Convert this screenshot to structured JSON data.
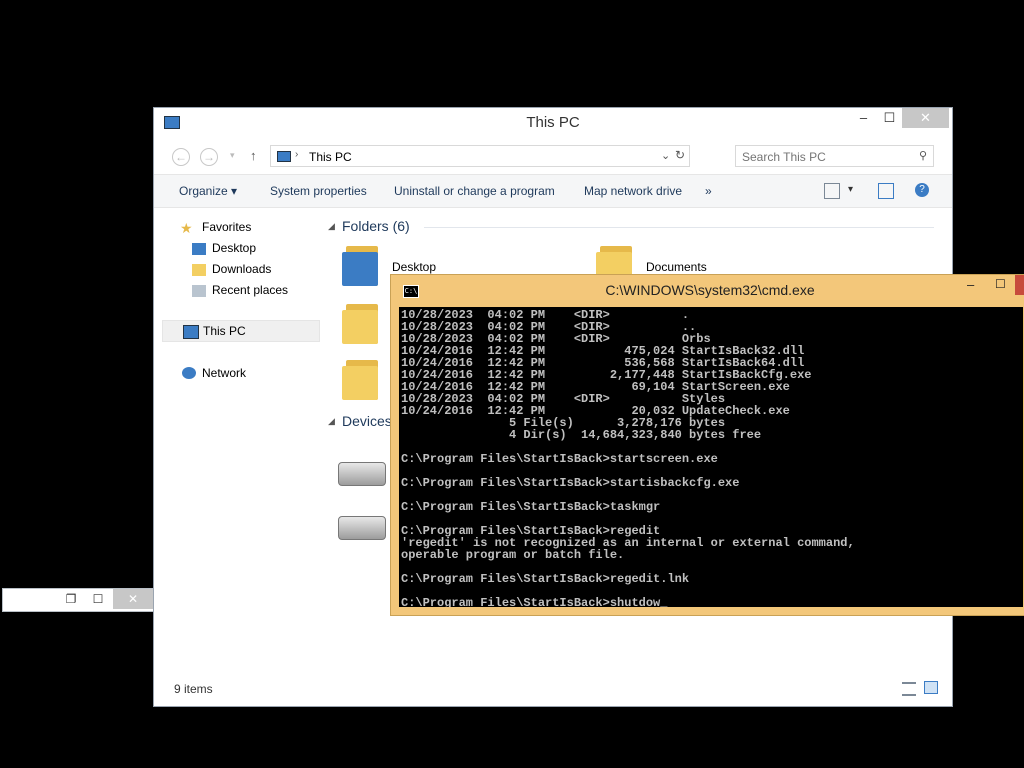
{
  "explorer": {
    "title": "This PC",
    "address": "This PC",
    "search_placeholder": "Search This PC",
    "toolbar": {
      "organize": "Organize",
      "system_properties": "System properties",
      "uninstall": "Uninstall or change a program",
      "map_drive": "Map network drive",
      "more": "»"
    },
    "nav": {
      "favorites": "Favorites",
      "desktop": "Desktop",
      "downloads": "Downloads",
      "recent": "Recent places",
      "this_pc": "This PC",
      "network": "Network"
    },
    "content": {
      "folders_header": "Folders (6)",
      "devices_header": "Devices",
      "desktop_label": "Desktop",
      "documents_label": "Documents"
    },
    "status": "9 items"
  },
  "cmd": {
    "title": "C:\\WINDOWS\\system32\\cmd.exe",
    "lines": [
      "10/28/2023  04:02 PM    <DIR>          .",
      "10/28/2023  04:02 PM    <DIR>          ..",
      "10/28/2023  04:02 PM    <DIR>          Orbs",
      "10/24/2016  12:42 PM           475,024 StartIsBack32.dll",
      "10/24/2016  12:42 PM           536,568 StartIsBack64.dll",
      "10/24/2016  12:42 PM         2,177,448 StartIsBackCfg.exe",
      "10/24/2016  12:42 PM            69,104 StartScreen.exe",
      "10/28/2023  04:02 PM    <DIR>          Styles",
      "10/24/2016  12:42 PM            20,032 UpdateCheck.exe",
      "               5 File(s)      3,278,176 bytes",
      "               4 Dir(s)  14,684,323,840 bytes free",
      "",
      "C:\\Program Files\\StartIsBack>startscreen.exe",
      "",
      "C:\\Program Files\\StartIsBack>startisbackcfg.exe",
      "",
      "C:\\Program Files\\StartIsBack>taskmgr",
      "",
      "C:\\Program Files\\StartIsBack>regedit",
      "'regedit' is not recognized as an internal or external command,",
      "operable program or batch file.",
      "",
      "C:\\Program Files\\StartIsBack>regedit.lnk",
      "",
      "C:\\Program Files\\StartIsBack>shutdow_"
    ]
  }
}
